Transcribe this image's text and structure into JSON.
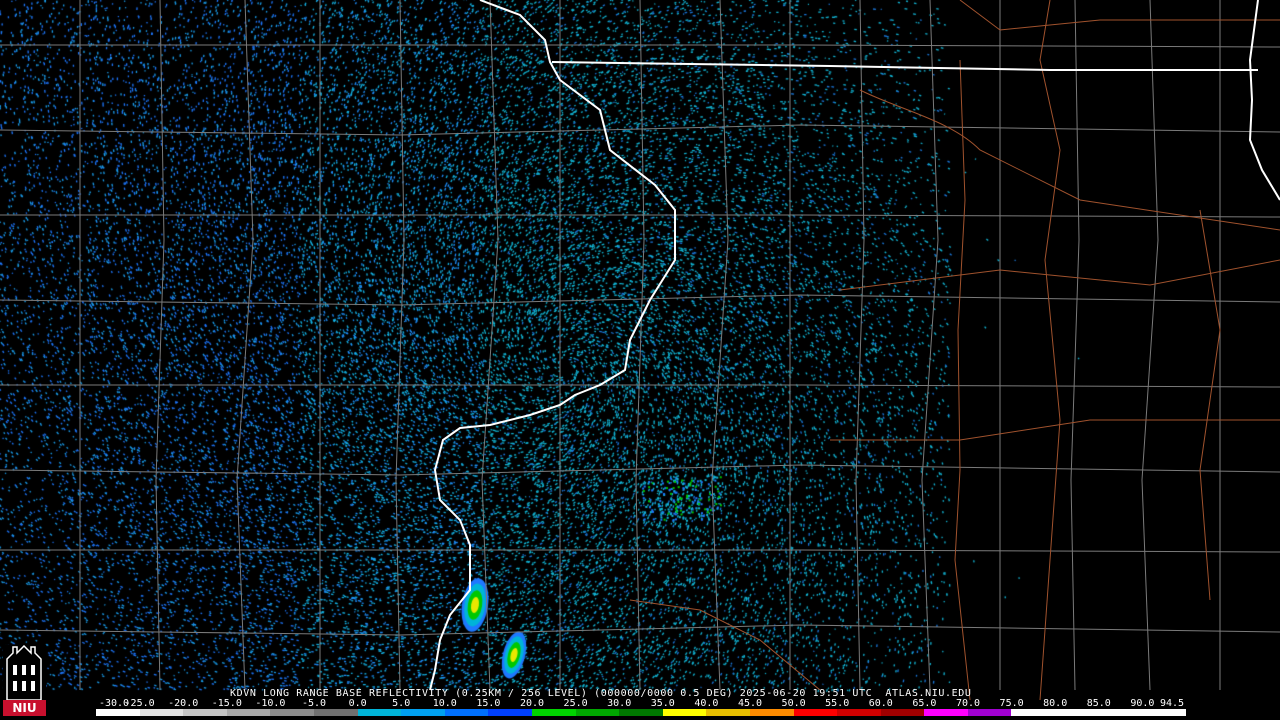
{
  "title": "KDVN LONG RANGE BASE REFLECTIVITY (0.25KM / 256 LEVEL) (000000/0000 0.5 DEG) 2025-06-20 19:51 UTC  ATLAS.NIU.EDU",
  "logo": {
    "name": "niu-logo",
    "text": "NIU"
  },
  "scale": {
    "labels": [
      "-30.0",
      "-25.0",
      "-20.0",
      "-15.0",
      "-10.0",
      "-5.0",
      "0.0",
      "5.0",
      "10.0",
      "15.0",
      "20.0",
      "25.0",
      "30.0",
      "35.0",
      "40.0",
      "45.0",
      "50.0",
      "55.0",
      "60.0",
      "65.0",
      "70.0",
      "75.0",
      "80.0",
      "85.0",
      "90.0",
      "94.5"
    ],
    "colors": [
      "#ffffff",
      "#e0e0e0",
      "#c4c4c4",
      "#a8a8a8",
      "#8c8c8c",
      "#707070",
      "#00b4d8",
      "#00a0f0",
      "#0070ff",
      "#0040ff",
      "#00d400",
      "#00a800",
      "#007800",
      "#ffff00",
      "#e8c000",
      "#ff8c00",
      "#ff0000",
      "#d00000",
      "#a00000",
      "#ff00ff",
      "#a000d0",
      "#ffffff",
      "#ffffff",
      "#ffffff",
      "#ffffff"
    ]
  },
  "colors": {
    "background": "#000000",
    "state_border": "#ffffff",
    "county_line": "#8a8a8a",
    "highway": "#a0522d"
  }
}
